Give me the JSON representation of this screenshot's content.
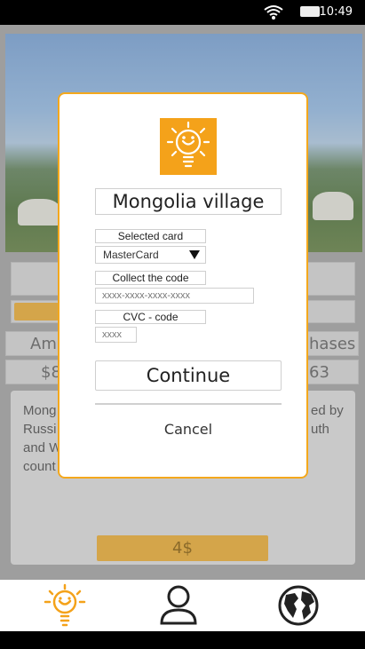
{
  "status_bar": {
    "time": "10:49"
  },
  "background": {
    "stat_left": "Am",
    "stat_right": "hases",
    "price_left": "$8",
    "price_right": "63",
    "desc_left_lines": [
      "Mong",
      "Russi",
      "and W",
      "count"
    ],
    "desc_right_lines": [
      "ed by",
      "uth"
    ],
    "price_button": "4$"
  },
  "dialog": {
    "title": "Mongolia village",
    "selected_card_label": "Selected card",
    "card_value": "MasterCard",
    "collect_code_label": "Collect the code",
    "card_number_placeholder": "xxxx-xxxx-xxxx-xxxx",
    "cvc_label": "CVC - code",
    "cvc_placeholder": "xxxx",
    "continue_label": "Continue",
    "cancel_label": "Cancel"
  },
  "bottom_nav": [
    {
      "icon": "lightbulb-icon"
    },
    {
      "icon": "user-icon"
    },
    {
      "icon": "globe-icon"
    }
  ],
  "colors": {
    "accent": "#f4a81c",
    "overlay_gray": "#9e9e9e"
  }
}
